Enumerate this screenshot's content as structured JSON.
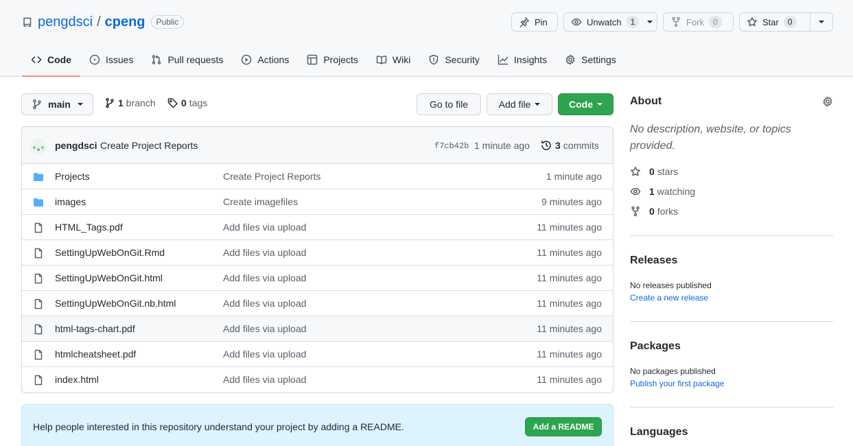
{
  "repo": {
    "owner": "pengdsci",
    "separator": "/",
    "name": "cpeng",
    "visibility": "Public"
  },
  "header_buttons": {
    "pin": {
      "label": "Pin"
    },
    "watch": {
      "label": "Unwatch",
      "count": "1"
    },
    "fork": {
      "label": "Fork",
      "count": "0"
    },
    "star": {
      "label": "Star",
      "count": "0"
    }
  },
  "tabs": [
    {
      "label": "Code",
      "icon": "code-icon",
      "active": true
    },
    {
      "label": "Issues",
      "icon": "issue-icon"
    },
    {
      "label": "Pull requests",
      "icon": "pull-request-icon"
    },
    {
      "label": "Actions",
      "icon": "play-icon"
    },
    {
      "label": "Projects",
      "icon": "table-icon"
    },
    {
      "label": "Wiki",
      "icon": "book-icon"
    },
    {
      "label": "Security",
      "icon": "shield-icon"
    },
    {
      "label": "Insights",
      "icon": "graph-icon"
    },
    {
      "label": "Settings",
      "icon": "gear-icon"
    }
  ],
  "toolbar": {
    "branch_select": "main",
    "branch_count": "1",
    "branch_label": "branch",
    "tag_count": "0",
    "tag_label": "tags",
    "go_to_file": "Go to file",
    "add_file": "Add file",
    "code": "Code"
  },
  "commit": {
    "author": "pengdsci",
    "message": "Create Project Reports",
    "sha": "f7cb42b",
    "age": "1 minute ago",
    "count": "3",
    "count_label": "commits"
  },
  "files": [
    {
      "type": "folder",
      "name": "Projects",
      "message": "Create Project Reports",
      "age": "1 minute ago"
    },
    {
      "type": "folder",
      "name": "images",
      "message": "Create imagefiles",
      "age": "9 minutes ago"
    },
    {
      "type": "file",
      "name": "HTML_Tags.pdf",
      "message": "Add files via upload",
      "age": "11 minutes ago"
    },
    {
      "type": "file",
      "name": "SettingUpWebOnGit.Rmd",
      "message": "Add files via upload",
      "age": "11 minutes ago"
    },
    {
      "type": "file",
      "name": "SettingUpWebOnGit.html",
      "message": "Add files via upload",
      "age": "11 minutes ago"
    },
    {
      "type": "file",
      "name": "SettingUpWebOnGit.nb.html",
      "message": "Add files via upload",
      "age": "11 minutes ago"
    },
    {
      "type": "file",
      "name": "html-tags-chart.pdf",
      "message": "Add files via upload",
      "age": "11 minutes ago"
    },
    {
      "type": "file",
      "name": "htmlcheatsheet.pdf",
      "message": "Add files via upload",
      "age": "11 minutes ago"
    },
    {
      "type": "file",
      "name": "index.html",
      "message": "Add files via upload",
      "age": "11 minutes ago"
    }
  ],
  "readme_banner": {
    "text": "Help people interested in this repository understand your project by adding a README.",
    "button": "Add a README"
  },
  "about": {
    "title": "About",
    "description_line1": "No description, website, or topics",
    "description_line2": "provided.",
    "stars_count": "0",
    "stars_label": "stars",
    "watching_count": "1",
    "watching_label": "watching",
    "forks_count": "0",
    "forks_label": "forks"
  },
  "releases": {
    "title": "Releases",
    "text": "No releases published",
    "link": "Create a new release"
  },
  "packages": {
    "title": "Packages",
    "text": "No packages published",
    "link": "Publish your first package"
  },
  "languages": {
    "title": "Languages"
  },
  "colors": {
    "accent_link": "#0969da",
    "primary_button": "#2da44e",
    "tab_underline": "#fd8c73",
    "folder": "#54aeff"
  }
}
